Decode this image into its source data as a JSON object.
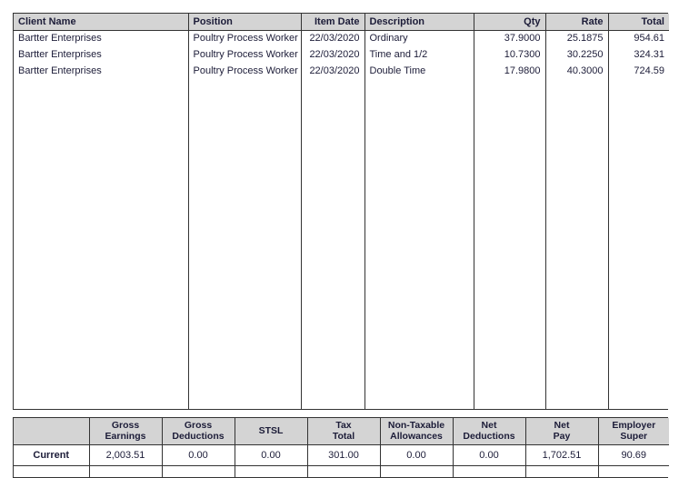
{
  "detail": {
    "columns": [
      {
        "key": "client_name",
        "label": "Client Name",
        "align": "l",
        "width": 192
      },
      {
        "key": "position",
        "label": "Position",
        "align": "l",
        "width": 124
      },
      {
        "key": "item_date",
        "label": "Item Date",
        "align": "r",
        "width": 70
      },
      {
        "key": "description",
        "label": "Description",
        "align": "l",
        "width": 120
      },
      {
        "key": "qty",
        "label": "Qty",
        "align": "r",
        "width": 79
      },
      {
        "key": "rate",
        "label": "Rate",
        "align": "r",
        "width": 69
      },
      {
        "key": "total",
        "label": "Total",
        "align": "r",
        "width": 67
      }
    ],
    "rows": [
      {
        "client_name": "Bartter Enterprises",
        "position": "Poultry Process Worker",
        "item_date": "22/03/2020",
        "description": "Ordinary",
        "qty": "37.9000",
        "rate": "25.1875",
        "total": "954.61"
      },
      {
        "client_name": "Bartter Enterprises",
        "position": "Poultry Process Worker",
        "item_date": "22/03/2020",
        "description": "Time and 1/2",
        "qty": "10.7300",
        "rate": "30.2250",
        "total": "324.31"
      },
      {
        "client_name": "Bartter Enterprises",
        "position": "Poultry Process Worker",
        "item_date": "22/03/2020",
        "description": "Double Time",
        "qty": "17.9800",
        "rate": "40.3000",
        "total": "724.59"
      }
    ]
  },
  "summary": {
    "columns": [
      {
        "key": "row_label",
        "label": "",
        "width": 83
      },
      {
        "key": "gross_earnings",
        "label": "Gross\nEarnings",
        "width": 80
      },
      {
        "key": "gross_deductions",
        "label": "Gross\nDeductions",
        "width": 80
      },
      {
        "key": "stsl",
        "label": "STSL",
        "width": 80
      },
      {
        "key": "tax_total",
        "label": "Tax\nTotal",
        "width": 80
      },
      {
        "key": "non_taxable_allowances",
        "label": "Non-Taxable\nAllowances",
        "width": 80
      },
      {
        "key": "net_deductions",
        "label": "Net\nDeductions",
        "width": 80
      },
      {
        "key": "net_pay",
        "label": "Net\nPay",
        "width": 80
      },
      {
        "key": "employer_super",
        "label": "Employer\nSuper",
        "width": 78
      }
    ],
    "rows": [
      {
        "row_label": "Current",
        "gross_earnings": "2,003.51",
        "gross_deductions": "0.00",
        "stsl": "0.00",
        "tax_total": "301.00",
        "non_taxable_allowances": "0.00",
        "net_deductions": "0.00",
        "net_pay": "1,702.51",
        "employer_super": "90.69"
      }
    ]
  },
  "colors": {
    "header_background": "#d4d4d4",
    "text": "#1c1c38",
    "border": "#333333",
    "page_background": "#ffffff"
  }
}
